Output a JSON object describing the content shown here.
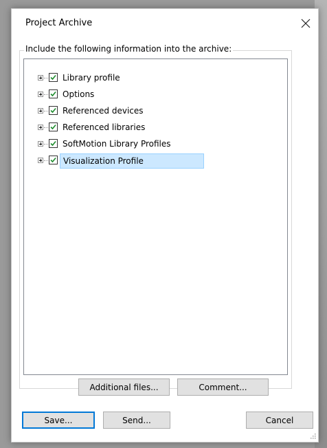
{
  "window": {
    "title": "Project Archive",
    "close_icon": "close-icon"
  },
  "group": {
    "legend": "Include the following information into the archive:"
  },
  "tree": {
    "items": [
      {
        "label": "Library profile",
        "checked": true,
        "selected": false
      },
      {
        "label": "Options",
        "checked": true,
        "selected": false
      },
      {
        "label": "Referenced devices",
        "checked": true,
        "selected": false
      },
      {
        "label": "Referenced libraries",
        "checked": true,
        "selected": false
      },
      {
        "label": "SoftMotion Library Profiles",
        "checked": true,
        "selected": false
      },
      {
        "label": "Visualization Profile",
        "checked": true,
        "selected": true
      }
    ]
  },
  "buttons": {
    "additional_files": "Additional files...",
    "comment": "Comment...",
    "save": "Save...",
    "send": "Send...",
    "cancel": "Cancel"
  },
  "colors": {
    "selection_fill": "#cce8ff",
    "selection_border": "#99d1ff",
    "checkmark": "#1e8c2e",
    "default_button_border": "#0078d7"
  }
}
